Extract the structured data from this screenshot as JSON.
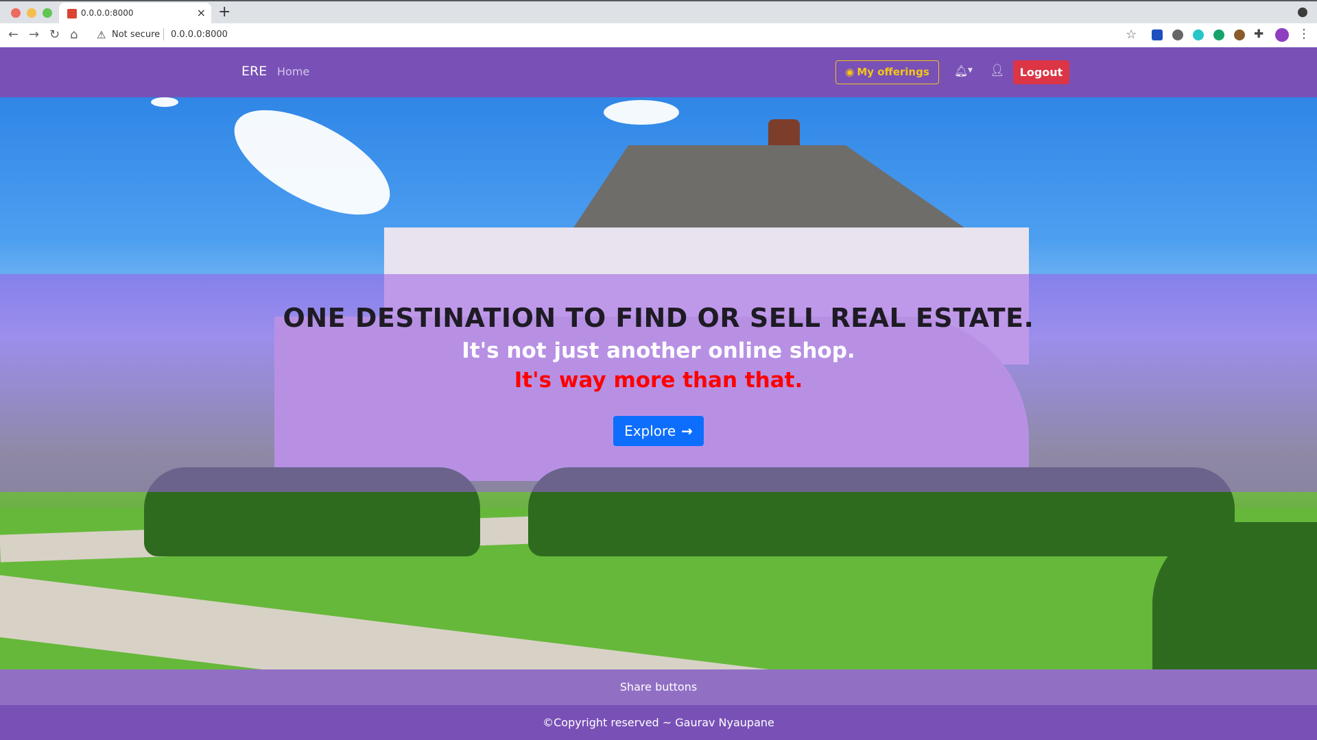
{
  "browser": {
    "tab_title": "0.0.0.0:8000",
    "security_label": "Not secure",
    "url": "0.0.0.0:8000"
  },
  "navbar": {
    "brand": "ERE",
    "home_link": "Home",
    "offerings_button": "My offerings",
    "logout_button": "Logout"
  },
  "hero": {
    "title": "ONE DESTINATION TO FIND OR SELL REAL ESTATE.",
    "subtitle": "It's not just another online shop.",
    "tagline": "It's way more than that.",
    "explore_button": "Explore"
  },
  "footer": {
    "share": "Share buttons",
    "copyright": "©Copyright reserved ~ Gaurav Nyaupane"
  },
  "colors": {
    "navbar": "#7951b6",
    "logout": "#dc3545",
    "explore": "#0d6efd",
    "offerings_outline": "#f2c020",
    "tagline": "#ff0000"
  },
  "icons": [
    "bell-icon",
    "user-icon",
    "coins-icon",
    "arrow-right-icon"
  ]
}
